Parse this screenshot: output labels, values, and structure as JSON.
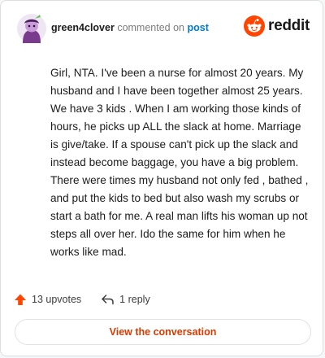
{
  "header": {
    "username": "green4clover",
    "action_text": "commented on",
    "post_link": "post",
    "brand": "reddit"
  },
  "comment": {
    "text": "Girl, NTA. I've been a nurse for almost 20 years. My husband and I have been together almost 25 years. We have 3 kids . When I am working those kinds of hours, he picks up ALL the slack at home. Marriage is give/take. If a spouse can't pick up the slack and instead become baggage, you have a big problem. There were times my husband not only fed , bathed , and put the kids to bed but also wash my scrubs or start a bath for me. A real man lifts his woman up not steps all over her. Ido the same for him when he works like mad."
  },
  "footer": {
    "upvotes_label": "13 upvotes",
    "replies_label": "1 reply",
    "cta_label": "View the conversation"
  },
  "colors": {
    "brand_orange": "#ff4500",
    "link_blue": "#0079d3",
    "cta_text": "#d93a00",
    "avatar_bg": "#7a3b8f"
  },
  "icons": {
    "avatar": "snoo-avatar-icon",
    "brand": "reddit-logo-icon",
    "upvote": "upvote-arrow-icon",
    "reply": "reply-arrow-icon"
  }
}
